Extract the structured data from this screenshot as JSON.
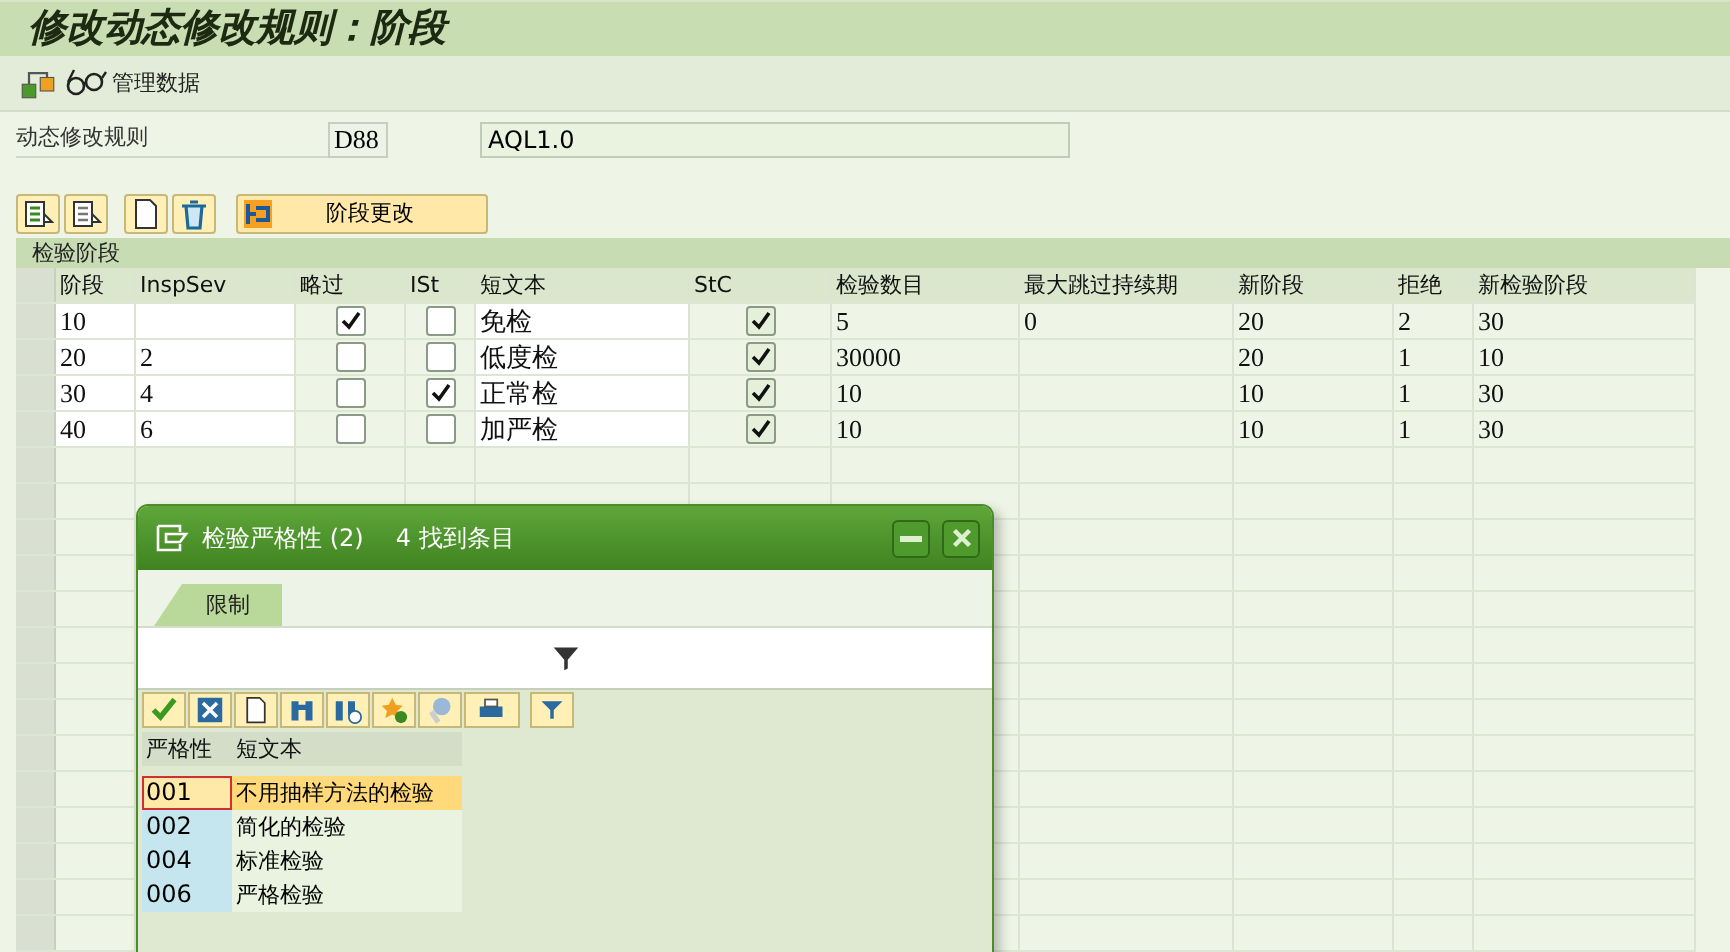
{
  "window": {
    "title": "修改动态修改规则：阶段"
  },
  "toolbar": {
    "manage_data_button": "管理数据"
  },
  "rule": {
    "label": "动态修改规则",
    "code": "D88",
    "description": "AQL1.0"
  },
  "table_toolbar": {
    "stage_change_button": "阶段更改"
  },
  "stages": {
    "title": "检验阶段",
    "columns": [
      "阶段",
      "InspSev",
      "略过",
      "ISt",
      "短文本",
      "StC",
      "检验数目",
      "最大跳过持续期",
      "新阶段",
      "拒绝",
      "新检验阶段"
    ],
    "rows": [
      {
        "stage": "10",
        "skip": true,
        "ist": false,
        "text": "免检",
        "stc": true,
        "count": "5",
        "max_skip": "0",
        "new_stage": "20",
        "reject": "2",
        "new_insp_stage": "30"
      },
      {
        "stage": "20",
        "insp_sev": "2",
        "skip": false,
        "ist": false,
        "text": "低度检",
        "stc": true,
        "count": "30000",
        "new_stage": "20",
        "reject": "1",
        "new_insp_stage": "10"
      },
      {
        "stage": "30",
        "insp_sev": "4",
        "skip": false,
        "ist": true,
        "text": "正常检",
        "stc": true,
        "count": "10",
        "new_stage": "10",
        "reject": "1",
        "new_insp_stage": "30"
      },
      {
        "stage": "40",
        "insp_sev": "6",
        "skip": false,
        "ist": false,
        "text": "加严检",
        "stc": true,
        "count": "10",
        "new_stage": "10",
        "reject": "1",
        "new_insp_stage": "30"
      }
    ]
  },
  "popup": {
    "title": "检验严格性 (2)",
    "count": "4 找到条目",
    "tabs": [
      {
        "label": "限制",
        "selected": true
      }
    ],
    "columns": [
      "严格性",
      "短文本"
    ],
    "rows": [
      {
        "code": "001",
        "text": "不用抽样方法的检验",
        "selected": true
      },
      {
        "code": "002",
        "text": "简化的检验",
        "selected": false
      },
      {
        "code": "004",
        "text": "标准检验",
        "selected": false
      },
      {
        "code": "006",
        "text": "严格检验",
        "selected": false
      }
    ]
  }
}
